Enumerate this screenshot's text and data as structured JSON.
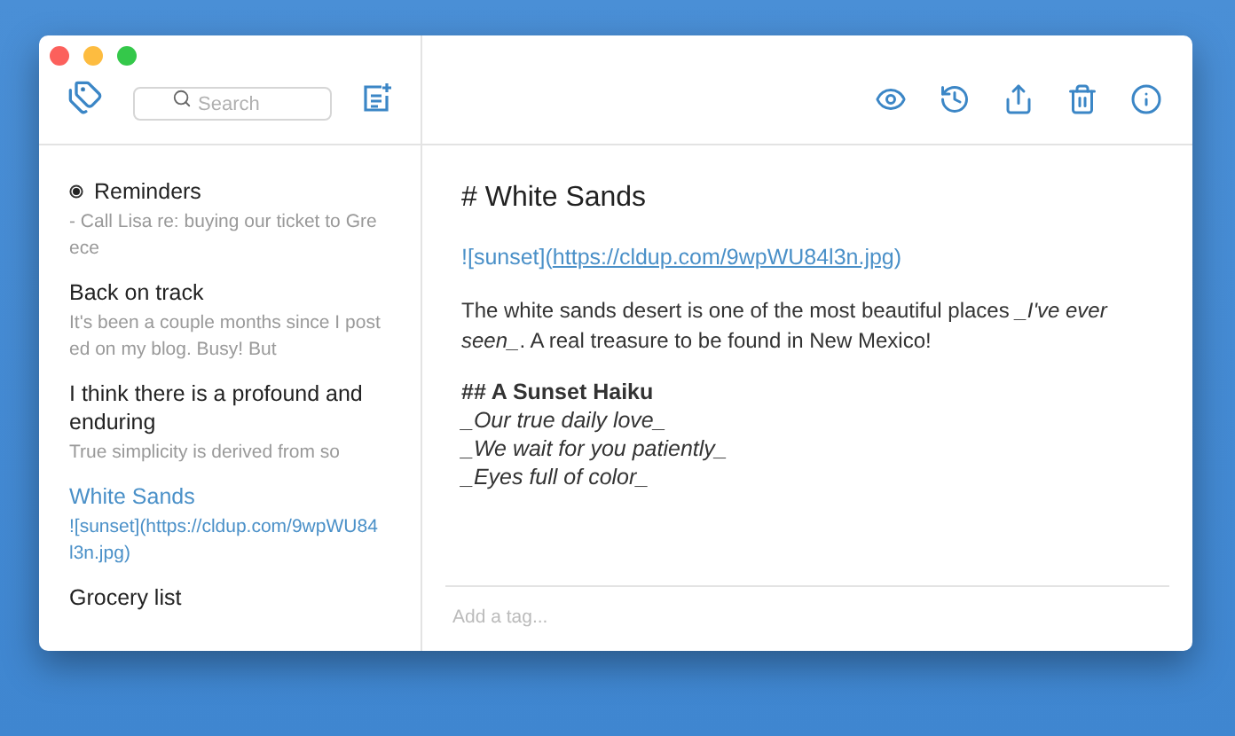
{
  "search": {
    "placeholder": "Search"
  },
  "notes": [
    {
      "kind": "reminder",
      "title": "Reminders",
      "snippet": "- Call Lisa re: buying our ticket to Greece",
      "selected": false
    },
    {
      "kind": "note",
      "title": "Back on track",
      "snippet": "It's been a couple months since I posted on my blog. Busy! But",
      "selected": false
    },
    {
      "kind": "note",
      "title": "I think there is a profound and enduring",
      "snippet": "True simplicity is derived from so",
      "selected": false
    },
    {
      "kind": "note",
      "title": "White Sands",
      "snippet": "![sunset](https://cldup.com/9wpWU84l3n.jpg)",
      "selected": true
    },
    {
      "kind": "note",
      "title": "Grocery list",
      "selected": false
    }
  ],
  "editor": {
    "blocks": [
      {
        "kind": "heading",
        "text": "# White Sands"
      },
      {
        "kind": "image",
        "prefix": "![sunset](",
        "url": "https://cldup.com/9wpWU84l3n.jpg",
        "suffix": ")"
      },
      {
        "kind": "paragraph",
        "text": "The white sands desert is one of the most beautiful places *_I've ever seen_*.  A real treasure to be found in New Mexico!"
      },
      {
        "kind": "subheading",
        "text": "## A Sunset Haiku"
      },
      {
        "kind": "italic",
        "text": "_Our true daily love_"
      },
      {
        "kind": "italic",
        "text": "_We wait for you patiently_"
      },
      {
        "kind": "italic",
        "text": "_Eyes full of color_"
      }
    ]
  },
  "tags": {
    "placeholder": "Add a tag..."
  }
}
